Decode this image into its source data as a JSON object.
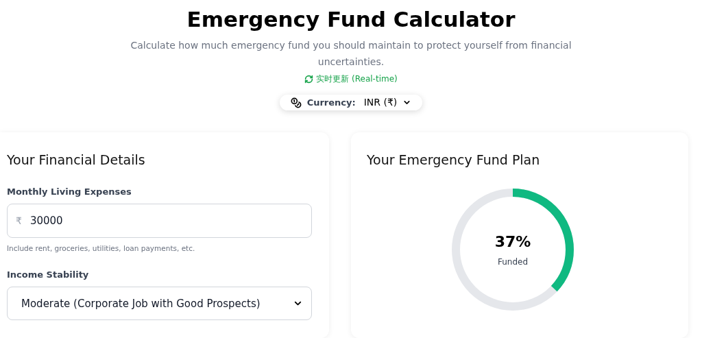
{
  "header": {
    "title": "Emergency Fund Calculator",
    "subtitle": "Calculate how much emergency fund you should maintain to protect yourself from financial uncertainties.",
    "realtime": "实时更新 (Real-time)"
  },
  "currency": {
    "label": "Currency:",
    "value": "INR (₹)"
  },
  "details": {
    "title": "Your Financial Details",
    "fields": [
      {
        "kind": "input",
        "label": "Monthly Living Expenses",
        "prefix": "₹",
        "value": "30000",
        "hint": "Include rent, groceries, utilities, loan payments, etc."
      },
      {
        "kind": "select",
        "label": "Income Stability",
        "value": "Moderate (Corporate Job with Good Prospects)"
      }
    ]
  },
  "plan": {
    "title": "Your Emergency Fund Plan",
    "progress": {
      "percent": "37%",
      "caption": "Funded"
    }
  }
}
